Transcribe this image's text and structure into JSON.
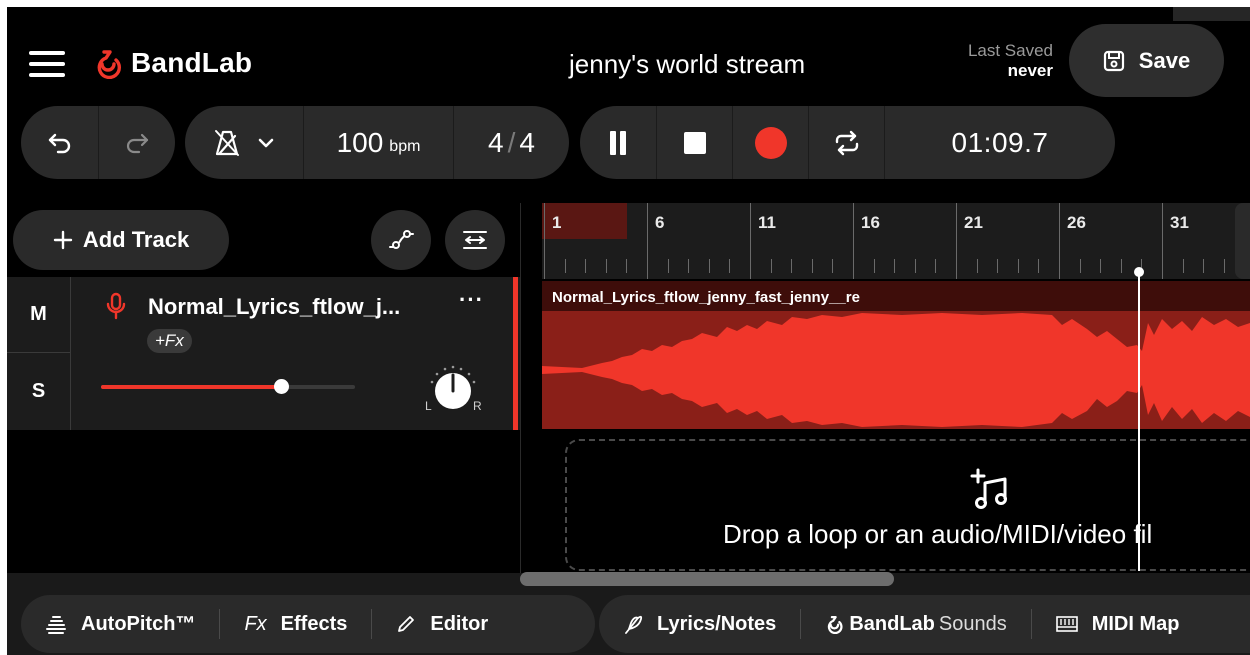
{
  "header": {
    "brand": "BandLab",
    "project_title": "jenny's world stream",
    "last_saved_label": "Last Saved",
    "last_saved_value": "never",
    "save_label": "Save"
  },
  "transport": {
    "bpm_value": "100",
    "bpm_unit": "bpm",
    "ts_numerator": "4",
    "ts_slash": "/",
    "ts_denominator": "4",
    "time": "01:09.7"
  },
  "tracks_panel": {
    "add_track_label": "Add Track"
  },
  "track": {
    "mute_label": "M",
    "solo_label": "S",
    "name": "Normal_Lyrics_ftlow_j...",
    "more_label": "···",
    "fx_label": "+Fx",
    "pan_left": "L",
    "pan_right": "R",
    "volume_fraction": 0.71
  },
  "ruler": {
    "bars": [
      "1",
      "6",
      "11",
      "16",
      "21",
      "26",
      "31"
    ]
  },
  "clip": {
    "name": "Normal_Lyrics_ftlow_jenny_fast_jenny__re"
  },
  "drop_zone": {
    "text": "Drop a loop or an audio/MIDI/video fil"
  },
  "bottom_tools": {
    "autopitch": "AutoPitch™",
    "fx_icon": "Fx",
    "effects": "Effects",
    "editor": "Editor",
    "lyrics": "Lyrics/Notes",
    "sounds_brand": "BandLab",
    "sounds_sub": "Sounds",
    "midi_map": "MIDI Map"
  },
  "colors": {
    "accent": "#f0362a",
    "background": "#000000",
    "panel": "#2a2a2a"
  }
}
